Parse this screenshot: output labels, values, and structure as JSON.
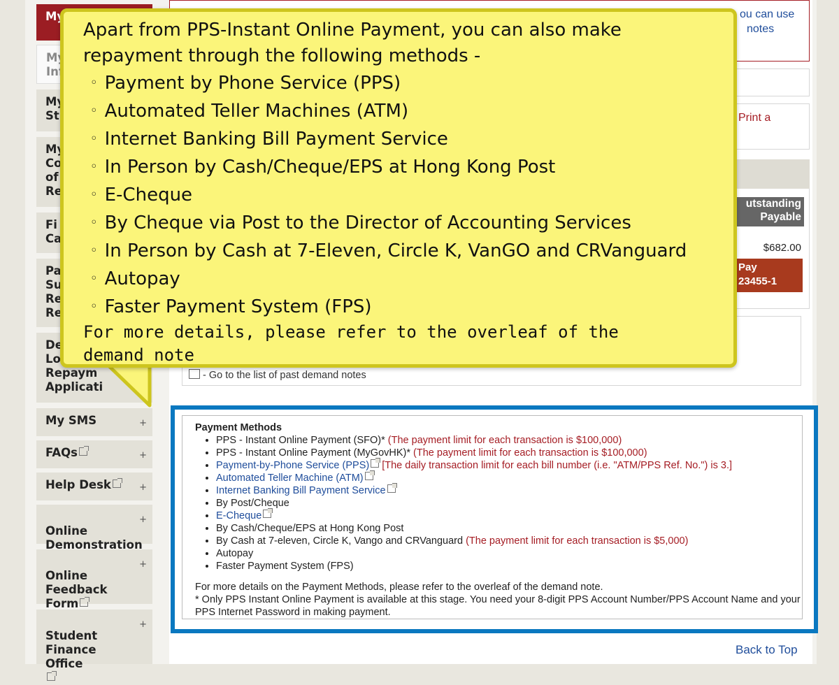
{
  "sidebar": {
    "items": [
      {
        "label": "My",
        "state": "active"
      },
      {
        "label": "My\nInf",
        "state": "light"
      },
      {
        "label": "My\nSt"
      },
      {
        "label": "My\nCo\nof\nRe"
      },
      {
        "label": "Fi\nCa"
      },
      {
        "label": "Pa\nSu\nRe\nRe"
      },
      {
        "label": "De\nLo\nRepaym\nApplicati"
      },
      {
        "label": "My SMS"
      },
      {
        "label": "FAQs"
      },
      {
        "label": "Help Desk"
      },
      {
        "label": "Online\nDemonstration"
      },
      {
        "label": "Online\nFeedback\nForm"
      },
      {
        "label": "Student\nFinance Office"
      }
    ],
    "plus_symbol": "+"
  },
  "main": {
    "top_right_text_1": "ou can use",
    "top_right_text_2": "notes",
    "print_link": "Print a",
    "outstanding_header": "utstanding\nPayable",
    "amount": "$682.00",
    "pay_button": "Pay\n23455-1",
    "past_notes_link": "- Go to the list of past demand notes",
    "back_to_top": "Back to Top"
  },
  "payment_methods": {
    "title": "Payment Methods",
    "items": [
      {
        "text": "PPS - Instant Online Payment (SFO)*",
        "note": "(The payment limit for each transaction is $100,000)",
        "link": false
      },
      {
        "text": "PPS - Instant Online Payment (MyGovHK)*",
        "note": "(The payment limit for each transaction is $100,000)",
        "link": false
      },
      {
        "text": "Payment-by-Phone Service (PPS)",
        "note": "[The daily transaction limit for each bill number (i.e. \"ATM/PPS Ref. No.\") is 3.]",
        "link": true
      },
      {
        "text": "Automated Teller Machine (ATM)",
        "note": "",
        "link": true
      },
      {
        "text": "Internet Banking Bill Payment Service",
        "note": "",
        "link": true
      },
      {
        "text": "By Post/Cheque",
        "note": "",
        "link": false
      },
      {
        "text": "E-Cheque",
        "note": "",
        "link": true
      },
      {
        "text": "By Cash/Cheque/EPS at Hong Kong Post",
        "note": "",
        "link": false
      },
      {
        "text": "By Cash at 7-eleven, Circle K, Vango and CRVanguard",
        "note": "(The payment limit for each transaction is $5,000)",
        "link": false
      },
      {
        "text": "Autopay",
        "note": "",
        "link": false
      },
      {
        "text": "Faster Payment System (FPS)",
        "note": "",
        "link": false
      }
    ],
    "note_1": "For more details on the Payment Methods, please refer to the overleaf of the demand note.",
    "note_2": "* Only PPS Instant Online Payment is available at this stage. You need your 8-digit PPS Account Number/PPS Account Name and your PPS Internet Password in making payment."
  },
  "callout": {
    "intro": "Apart from PPS-Instant Online Payment, you can also make repayment through the following methods -",
    "bullet": "◦",
    "methods": [
      "Payment by Phone Service (PPS)",
      "Automated Teller Machines (ATM)",
      "Internet Banking Bill Payment Service",
      "In Person by Cash/Cheque/EPS at Hong Kong Post",
      "E-Cheque",
      "By Cheque via Post to the Director of Accounting Services",
      "In Person by Cash at 7-Eleven, Circle K, VanGO and CRVanguard",
      "Autopay",
      "Faster Payment System (FPS)"
    ],
    "more": "For more details, please refer to the overleaf of the demand note"
  },
  "colors": {
    "accent_red": "#9b1d23",
    "link_blue": "#1f4d9b",
    "highlight_blue": "#0a78c0",
    "callout_yellow": "#fbf57a"
  }
}
